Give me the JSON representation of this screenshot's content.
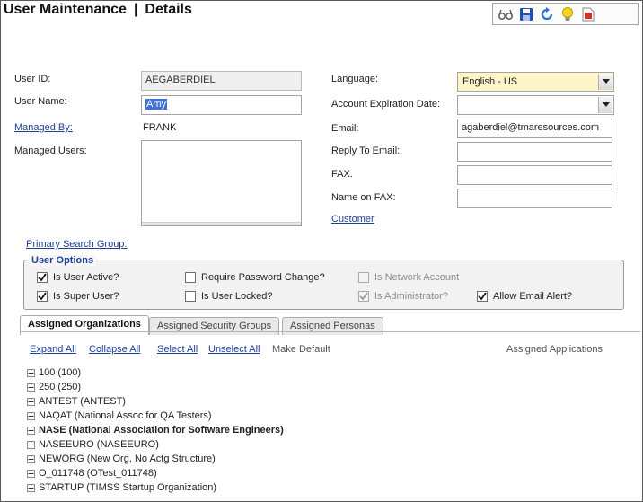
{
  "page": {
    "title": "User Maintenance",
    "separator": "|",
    "subtitle": "Details"
  },
  "toolbar": {
    "icons": [
      "glasses-icon",
      "save-disk-icon",
      "refresh-icon",
      "lightbulb-icon",
      "pdf-report-icon"
    ]
  },
  "form": {
    "user_id": {
      "label": "User ID:",
      "value": "AEGABERDIEL"
    },
    "user_name": {
      "label": "User Name:",
      "value": "Amy"
    },
    "managed_by": {
      "label": "Managed By:",
      "value": "FRANK"
    },
    "managed_users": {
      "label": "Managed Users:"
    },
    "language": {
      "label": "Language:",
      "value": "English - US"
    },
    "account_expiration": {
      "label": "Account Expiration Date:",
      "value": ""
    },
    "email": {
      "label": "Email:",
      "value": "agaberdiel@tmaresources.com"
    },
    "reply_to": {
      "label": "Reply To Email:",
      "value": ""
    },
    "fax": {
      "label": "FAX:",
      "value": ""
    },
    "name_on_fax": {
      "label": "Name on FAX:",
      "value": ""
    },
    "customer_link": "Customer",
    "primary_search_group": "Primary Search Group:"
  },
  "options": {
    "legend": "User Options",
    "items": [
      {
        "label": "Is User Active?",
        "checked": true,
        "disabled": false
      },
      {
        "label": "Require Password Change?",
        "checked": false,
        "disabled": false
      },
      {
        "label": "Is Network Account",
        "checked": false,
        "disabled": true
      },
      {
        "label": "Is Super User?",
        "checked": true,
        "disabled": false
      },
      {
        "label": "Is User Locked?",
        "checked": false,
        "disabled": false
      },
      {
        "label": "Is Administrator?",
        "checked": true,
        "disabled": true
      },
      {
        "label": "Allow Email Alert?",
        "checked": true,
        "disabled": false
      }
    ]
  },
  "tabs": [
    {
      "label": "Assigned Organizations",
      "active": true
    },
    {
      "label": "Assigned Security Groups",
      "active": false
    },
    {
      "label": "Assigned Personas",
      "active": false
    }
  ],
  "actions": {
    "expand_all": "Expand All",
    "collapse_all": "Collapse All",
    "select_all": "Select All",
    "unselect_all": "Unselect All",
    "make_default": "Make Default",
    "assigned_applications": "Assigned Applications"
  },
  "tree": [
    {
      "label": "100 (100)",
      "bold": false
    },
    {
      "label": "250 (250)",
      "bold": false
    },
    {
      "label": "ANTEST (ANTEST)",
      "bold": false
    },
    {
      "label": "NAQAT (National Assoc for QA Testers)",
      "bold": false
    },
    {
      "label": "NASE (National Association for Software Engineers)",
      "bold": true
    },
    {
      "label": "NASEEURO (NASEEURO)",
      "bold": false
    },
    {
      "label": "NEWORG (New Org, No Actg Structure)",
      "bold": false
    },
    {
      "label": "O_011748 (OTest_011748)",
      "bold": false
    },
    {
      "label": "STARTUP (TIMSS Startup Organization)",
      "bold": false
    }
  ]
}
